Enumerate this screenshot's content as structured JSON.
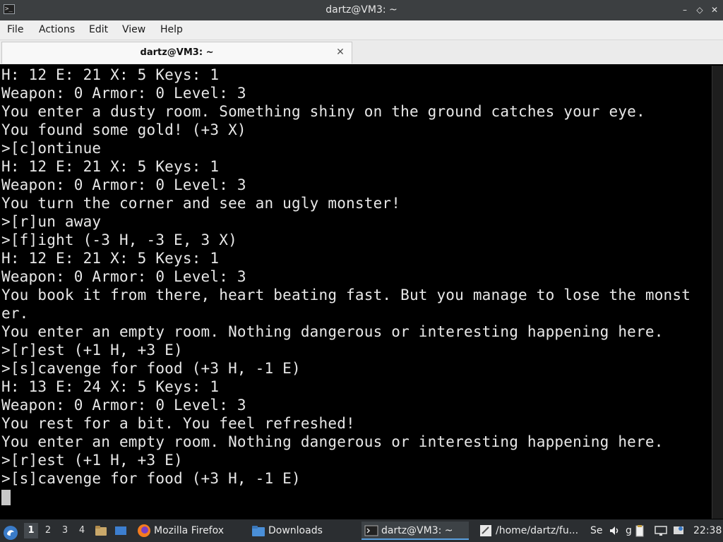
{
  "window": {
    "title": "dartz@VM3: ~",
    "app_icon_text": ">_",
    "buttons": {
      "minimize": "–",
      "restore": "◇",
      "maximize": "⤢",
      "close": "✕"
    }
  },
  "menu": {
    "items": [
      "File",
      "Actions",
      "Edit",
      "View",
      "Help"
    ]
  },
  "tab": {
    "label": "dartz@VM3: ~",
    "close": "✕"
  },
  "terminal": {
    "lines": [
      "H: 12 E: 21 X: 5 Keys: 1",
      "Weapon: 0 Armor: 0 Level: 3",
      "You enter a dusty room. Something shiny on the ground catches your eye.",
      "You found some gold! (+3 X)",
      ">[c]ontinue",
      "H: 12 E: 21 X: 5 Keys: 1",
      "Weapon: 0 Armor: 0 Level: 3",
      "You turn the corner and see an ugly monster!",
      ">[r]un away",
      ">[f]ight (-3 H, -3 E, 3 X)",
      "H: 12 E: 21 X: 5 Keys: 1",
      "Weapon: 0 Armor: 0 Level: 3",
      "You book it from there, heart beating fast. But you manage to lose the monst",
      "er.",
      "You enter an empty room. Nothing dangerous or interesting happening here.",
      ">[r]est (+1 H, +3 E)",
      ">[s]cavenge for food (+3 H, -1 E)",
      "H: 13 E: 24 X: 5 Keys: 1",
      "Weapon: 0 Armor: 0 Level: 3",
      "You rest for a bit. You feel refreshed!",
      "You enter an empty room. Nothing dangerous or interesting happening here.",
      ">[r]est (+1 H, +3 E)",
      ">[s]cavenge for food (+3 H, -1 E)"
    ]
  },
  "taskbar": {
    "workspaces": [
      "1",
      "2",
      "3",
      "4"
    ],
    "active_workspace": "1",
    "tasks": {
      "firefox": "Mozilla Firefox",
      "downloads": "Downloads",
      "terminal": "dartz@VM3: ~",
      "editor": "/home/dartz/fu...",
      "extra1": "Se",
      "extra2": "g"
    },
    "clock": "22:38"
  },
  "colors": {
    "titlebar": "#3c3f41",
    "terminal_bg": "#000000",
    "terminal_fg": "#e8e8e8",
    "taskbar": "#2b2e31",
    "accent": "#5aa0e0"
  }
}
